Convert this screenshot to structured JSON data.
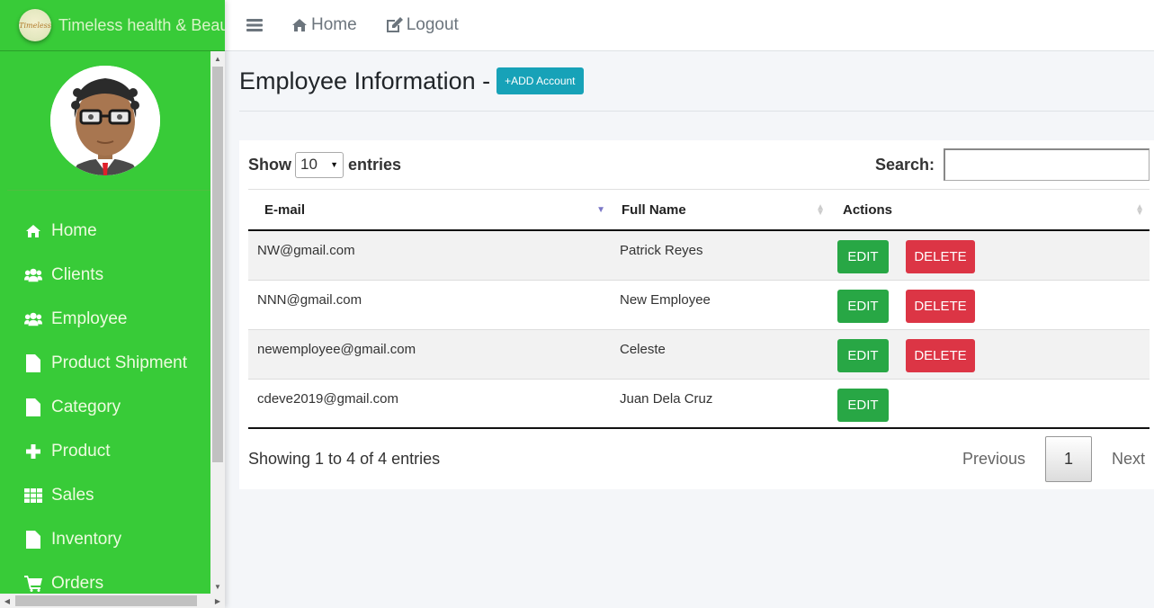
{
  "brand": {
    "name": "Timeless health & Beauty",
    "logo_text": "Timeless",
    "color": "#38cb38"
  },
  "sidebar": {
    "items": [
      {
        "label": "Home",
        "icon": "home-icon"
      },
      {
        "label": "Clients",
        "icon": "users-icon"
      },
      {
        "label": "Employee",
        "icon": "users-icon"
      },
      {
        "label": "Product Shipment",
        "icon": "file-icon"
      },
      {
        "label": "Category",
        "icon": "file-icon"
      },
      {
        "label": "Product",
        "icon": "plus-icon"
      },
      {
        "label": "Sales",
        "icon": "grid-icon"
      },
      {
        "label": "Inventory",
        "icon": "file-icon"
      },
      {
        "label": "Orders",
        "icon": "cart-icon"
      }
    ]
  },
  "topbar": {
    "home_label": "Home",
    "logout_label": "Logout"
  },
  "page": {
    "title": "Employee Information -",
    "add_button": "+ADD Account"
  },
  "datatable": {
    "show_label": "Show",
    "entries_label": "entries",
    "page_length": "10",
    "search_label": "Search:",
    "search_value": "",
    "columns": [
      "E-mail",
      "Full Name",
      "Actions"
    ],
    "rows": [
      {
        "email": "NW@gmail.com",
        "name": "Patrick Reyes",
        "edit": "EDIT",
        "delete": "DELETE"
      },
      {
        "email": "NNN@gmail.com",
        "name": "New Employee",
        "edit": "EDIT",
        "delete": "DELETE"
      },
      {
        "email": "newemployee@gmail.com",
        "name": "Celeste",
        "edit": "EDIT",
        "delete": "DELETE"
      },
      {
        "email": "cdeve2019@gmail.com",
        "name": "Juan Dela Cruz",
        "edit": "EDIT",
        "delete": null
      }
    ],
    "info": "Showing 1 to 4 of 4 entries",
    "pagination": {
      "previous": "Previous",
      "current": "1",
      "next": "Next"
    }
  },
  "colors": {
    "edit": "#28a745",
    "delete": "#dc3545",
    "add": "#17a2b8"
  }
}
